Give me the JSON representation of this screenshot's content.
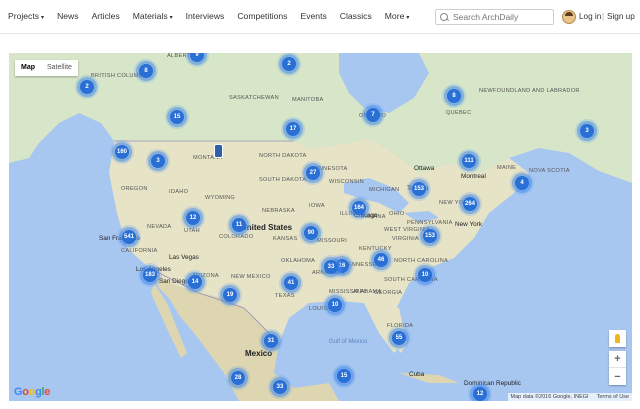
{
  "nav": {
    "items": [
      {
        "label": "Projects",
        "dropdown": true
      },
      {
        "label": "News",
        "dropdown": false
      },
      {
        "label": "Articles",
        "dropdown": false
      },
      {
        "label": "Materials",
        "dropdown": true
      },
      {
        "label": "Interviews",
        "dropdown": false
      },
      {
        "label": "Competitions",
        "dropdown": false
      },
      {
        "label": "Events",
        "dropdown": false
      },
      {
        "label": "Classics",
        "dropdown": false
      },
      {
        "label": "More",
        "dropdown": true
      }
    ],
    "search_placeholder": "Search ArchDaily",
    "login_label": "Log in",
    "separator": "|",
    "signup_label": "Sign up"
  },
  "map": {
    "map_type": {
      "map": "Map",
      "satellite": "Satellite",
      "selected": "Map"
    },
    "zoom_in": "+",
    "zoom_out": "−",
    "attribution": "Map data ©2016 Google, INEGI",
    "terms": "Terms of Use",
    "logo": "Google",
    "clusters": [
      "9",
      "2",
      "2",
      "8",
      "8",
      "15",
      "7",
      "17",
      "160",
      "3",
      "3",
      "111",
      "4",
      "27",
      "153",
      "264",
      "12",
      "11",
      "164",
      "541",
      "90",
      "153",
      "16",
      "46",
      "183",
      "14",
      "10",
      "41",
      "33",
      "19",
      "10",
      "55",
      "31",
      "28",
      "15",
      "33",
      "12"
    ],
    "labels": {
      "countries": [
        "United States",
        "Mexico"
      ],
      "regions": [
        "ALBERTA",
        "BRITISH COLUMBIA",
        "SASKATCHEWAN",
        "MANITOBA",
        "ONTARIO",
        "QUEBEC",
        "NEWFOUNDLAND AND LABRADOR",
        "MONTANA",
        "NORTH DAKOTA",
        "SOUTH DAKOTA",
        "OREGON",
        "IDAHO",
        "WYOMING",
        "NEBRASKA",
        "NEVADA",
        "UTAH",
        "COLORADO",
        "KANSAS",
        "OKLAHOMA",
        "NEW MEXICO",
        "TEXAS",
        "ARIZONA",
        "MINNESOTA",
        "WISCONSIN",
        "MICHIGAN",
        "IOWA",
        "ILLINOIS",
        "MISSOURI",
        "INDIANA",
        "OHIO",
        "KENTUCKY",
        "TENNESSEE",
        "ARKANSAS",
        "MISSISSIPPI",
        "ALABAMA",
        "GEORGIA",
        "LOUISIANA",
        "FLORIDA",
        "PENNSYLVANIA",
        "VIRGINIA",
        "NORTH CAROLINA",
        "SOUTH CAROLINA",
        "WEST VIRGINIA",
        "NEW YORK",
        "MAINE",
        "NOVA SCOTIA",
        "CALIFORNIA"
      ],
      "cities": [
        "Ottawa",
        "Toronto",
        "Chicago",
        "New York",
        "San Francisco",
        "Los Angeles",
        "Las Vegas",
        "San Diego",
        "Cuba",
        "Dominican Republic",
        "Montreal"
      ],
      "water": [
        "Gulf of Mexico"
      ]
    }
  }
}
